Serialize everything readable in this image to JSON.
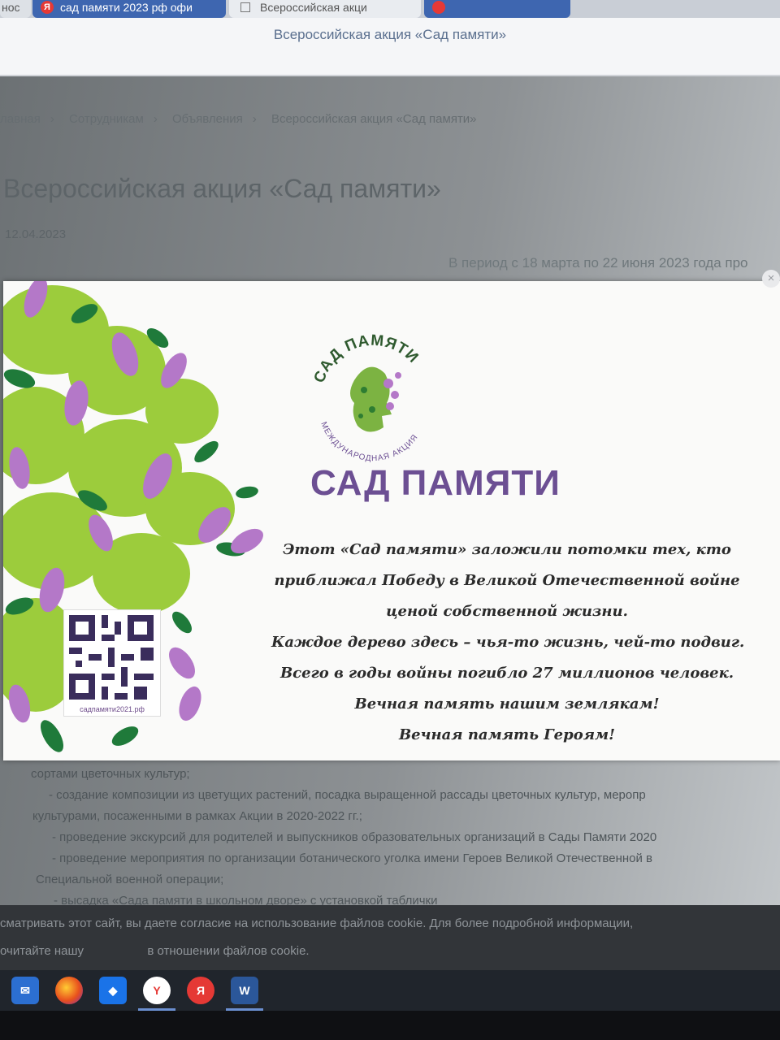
{
  "browser": {
    "tabs": [
      {
        "label": "нос"
      },
      {
        "label": "сад памяти 2023 рф офи"
      },
      {
        "label": "Всероссийская акци"
      },
      {
        "label": ""
      }
    ],
    "page_title": "Всероссийская акция «Сад памяти»"
  },
  "page": {
    "breadcrumbs": [
      "лавная",
      "Сотрудникам",
      "Объявления",
      "Всероссийская акция «Сад памяти»"
    ],
    "breadcrumb_separator": "›",
    "title": "Всероссийская акция «Сад памяти»",
    "date": "12.04.2023",
    "intro": "В период с 18 марта по 22 июня 2023 года про",
    "body_lines": [
      "сортами цветочных культур;",
      "- создание композиции из цветущих растений, посадка выращенной рассады цветочных культур, меропр",
      "культурами, посаженными в рамках Акции в 2020-2022 гг.;",
      "- проведение экскурсий для родителей и выпускников образовательных организаций в Сады Памяти 2020",
      "- проведение мероприятия по организации ботанического уголка имени Героев Великой Отечественной в",
      "Специальной военной операции;",
      "- высадка «Сада памяти в школьном дворе» с установкой таблички"
    ]
  },
  "modal": {
    "close_label": "×",
    "logo_arc_top": "САД ПАМЯТИ",
    "logo_arc_bottom": "МЕЖДУНАРОДНАЯ АКЦИЯ",
    "heading": "САД ПАМЯТИ",
    "poem": [
      "Этот «Сад памяти» заложили потомки тех, кто",
      "приближал Победу в Великой Отечественной войне",
      "ценой собственной жизни.",
      "Каждое дерево здесь – чья-то жизнь, чей-то подвиг.",
      "Всего в годы войны погибло 27 миллионов человек.",
      "Вечная память нашим землякам!",
      "Вечная память Героям!"
    ],
    "qr_caption": "садпамяти2021.рф",
    "colors": {
      "purple": "#6c4f93",
      "lilac": "#b478c8",
      "leaf_light": "#9ccc3c",
      "leaf_dark": "#1f7a3a"
    }
  },
  "cookie": {
    "line1": "сматривать этот сайт, вы даете согласие на использование файлов cookie. Для более подробной информации,",
    "line2_start": "очитайте нашу",
    "line2_link": "",
    "line2_end": "в отношении файлов cookie."
  },
  "taskbar": {
    "apps": [
      {
        "name": "mail-icon",
        "glyph": "✉"
      },
      {
        "name": "firefox-icon",
        "glyph": ""
      },
      {
        "name": "dropbox-icon",
        "glyph": "◆"
      },
      {
        "name": "yandex-browser-icon",
        "glyph": "Y"
      },
      {
        "name": "yandex-icon",
        "glyph": "Я"
      },
      {
        "name": "word-icon",
        "glyph": "W"
      }
    ]
  }
}
